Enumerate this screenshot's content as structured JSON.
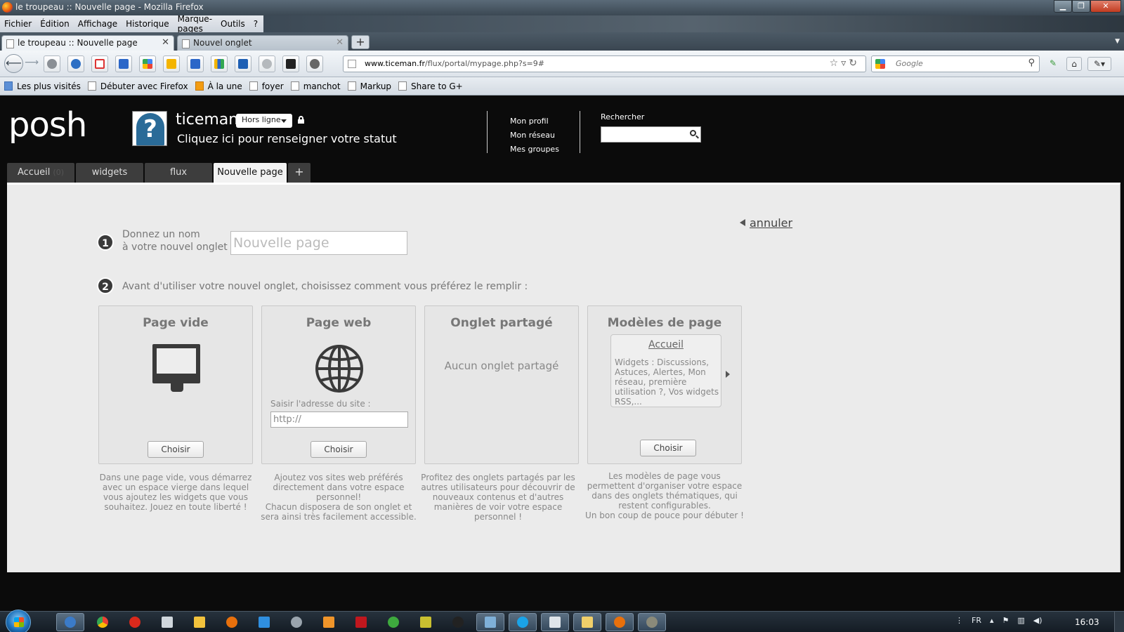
{
  "window": {
    "title": "le troupeau :: Nouvelle page - Mozilla Firefox"
  },
  "menu": [
    "Fichier",
    "Édition",
    "Affichage",
    "Historique",
    "Marque-pages",
    "Outils",
    "?"
  ],
  "browser_tabs": [
    {
      "label": "le troupeau :: Nouvelle page",
      "active": true
    },
    {
      "label": "Nouvel onglet",
      "active": false
    }
  ],
  "address": {
    "domain": "www.ticeman.fr",
    "path": "/flux/portal/mypage.php?s=9#"
  },
  "search_engine": {
    "placeholder": "Google"
  },
  "bookmarks": [
    "Les plus visités",
    "Débuter avec Firefox",
    "À la une",
    "foyer",
    "manchot",
    "Markup",
    "Share to G+"
  ],
  "posh": {
    "logo": "posh",
    "username": "ticeman",
    "status": "Hors ligne",
    "status_message": "Cliquez ici pour renseigner votre statut",
    "links": [
      "Mon profil",
      "Mon réseau",
      "Mes groupes"
    ],
    "search_label": "Rechercher",
    "tabs": [
      {
        "label": "Accueil",
        "active": false
      },
      {
        "label": "widgets",
        "active": false
      },
      {
        "label": "flux",
        "active": false
      },
      {
        "label": "Nouvelle page",
        "active": true
      }
    ],
    "add_tab": "+"
  },
  "newpage": {
    "cancel": "annuler",
    "step1_number": "1",
    "step1_line1": "Donnez un nom",
    "step1_line2": "à votre nouvel onglet :",
    "name_placeholder": "Nouvelle page",
    "step2_number": "2",
    "step2_text": "Avant d'utiliser votre nouvel onglet, choisissez comment vous préférez le remplir :",
    "choose": "Choisir",
    "cards": {
      "empty": {
        "title": "Page vide",
        "desc": "Dans une page vide, vous démarrez avec un espace vierge dans lequel vous ajoutez les widgets que vous souhaitez. Jouez en toute liberté !"
      },
      "web": {
        "title": "Page web",
        "site_label": "Saisir l'adresse du site :",
        "url_value": "http://",
        "desc1": "Ajoutez vos sites web préférés directement dans votre espace personnel!",
        "desc2": "Chacun disposera de son onglet et sera ainsi très facilement accessible."
      },
      "shared": {
        "title": "Onglet partagé",
        "empty_msg": "Aucun onglet partagé",
        "desc": "Profitez des onglets partagés par les autres utilisateurs pour découvrir de nouveaux contenus et d'autres manières de voir votre espace personnel !"
      },
      "templates": {
        "title": "Modèles de page",
        "template_name": "Accueil",
        "template_widgets": "Widgets : Discussions, Astuces, Alertes, Mon réseau, première utilisation ?, Vos widgets RSS,...",
        "desc1": "Les modèles de page vous permettent d'organiser votre espace dans des onglets thématiques, qui restent configurables.",
        "desc2": "Un bon coup de pouce pour débuter !"
      }
    }
  },
  "taskbar": {
    "lang": "FR",
    "time": "16:03"
  },
  "colors": {
    "posh_bg": "#0b0b0b",
    "content_bg": "#ebebeb",
    "tab_bg": "#3d3d3d"
  }
}
